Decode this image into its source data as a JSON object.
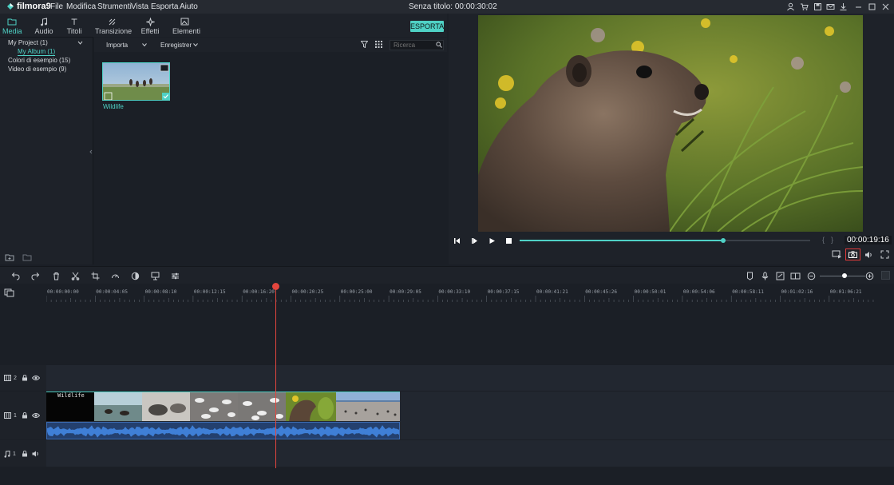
{
  "app": {
    "name": "filmora9",
    "doc_title": "Senza titolo: 00:00:30:02"
  },
  "menu": [
    "File",
    "Modifica",
    "Strumenti",
    "Vista",
    "Esporta",
    "Aiuto"
  ],
  "tabs": [
    {
      "label": "Media",
      "icon": "folder-icon",
      "active": true
    },
    {
      "label": "Audio",
      "icon": "music-note-icon"
    },
    {
      "label": "Titoli",
      "icon": "text-icon"
    },
    {
      "label": "Transizione",
      "icon": "transition-icon"
    },
    {
      "label": "Effetti",
      "icon": "effects-icon"
    },
    {
      "label": "Elementi",
      "icon": "image-icon"
    }
  ],
  "export_label": "ESPORTA",
  "library": {
    "project": "My Project (1)",
    "album": "My Album (1)",
    "colors": "Colori di esempio (15)",
    "videos": "Video di esempio (9)"
  },
  "media_toolbar": {
    "import_label": "Importa",
    "record_label": "Enregistrer",
    "search_placeholder": "Ricerca"
  },
  "media_items": [
    {
      "name": "Wildlife"
    }
  ],
  "preview": {
    "timecode": "00:00:19:16",
    "progress": 0.7
  },
  "timeline": {
    "ticks": [
      "00:00:00:00",
      "00:00:04:05",
      "00:00:08:10",
      "00:00:12:15",
      "00:00:16:20",
      "00:00:20:25",
      "00:00:25:00",
      "00:00:29:05",
      "00:00:33:10",
      "00:00:37:15",
      "00:00:41:21",
      "00:00:45:26",
      "00:00:50:01",
      "00:00:54:06",
      "00:00:58:11",
      "00:01:02:16",
      "00:01:06:21"
    ],
    "tracks": [
      {
        "num": "2",
        "type": "video"
      },
      {
        "num": "1",
        "type": "video"
      },
      {
        "num": "1",
        "type": "audio"
      }
    ],
    "clip_title": "Wildlife"
  },
  "colors": {
    "accent": "#4fd1c5",
    "playhead": "#e4463e",
    "audio_wave": "#3f7fd6"
  }
}
